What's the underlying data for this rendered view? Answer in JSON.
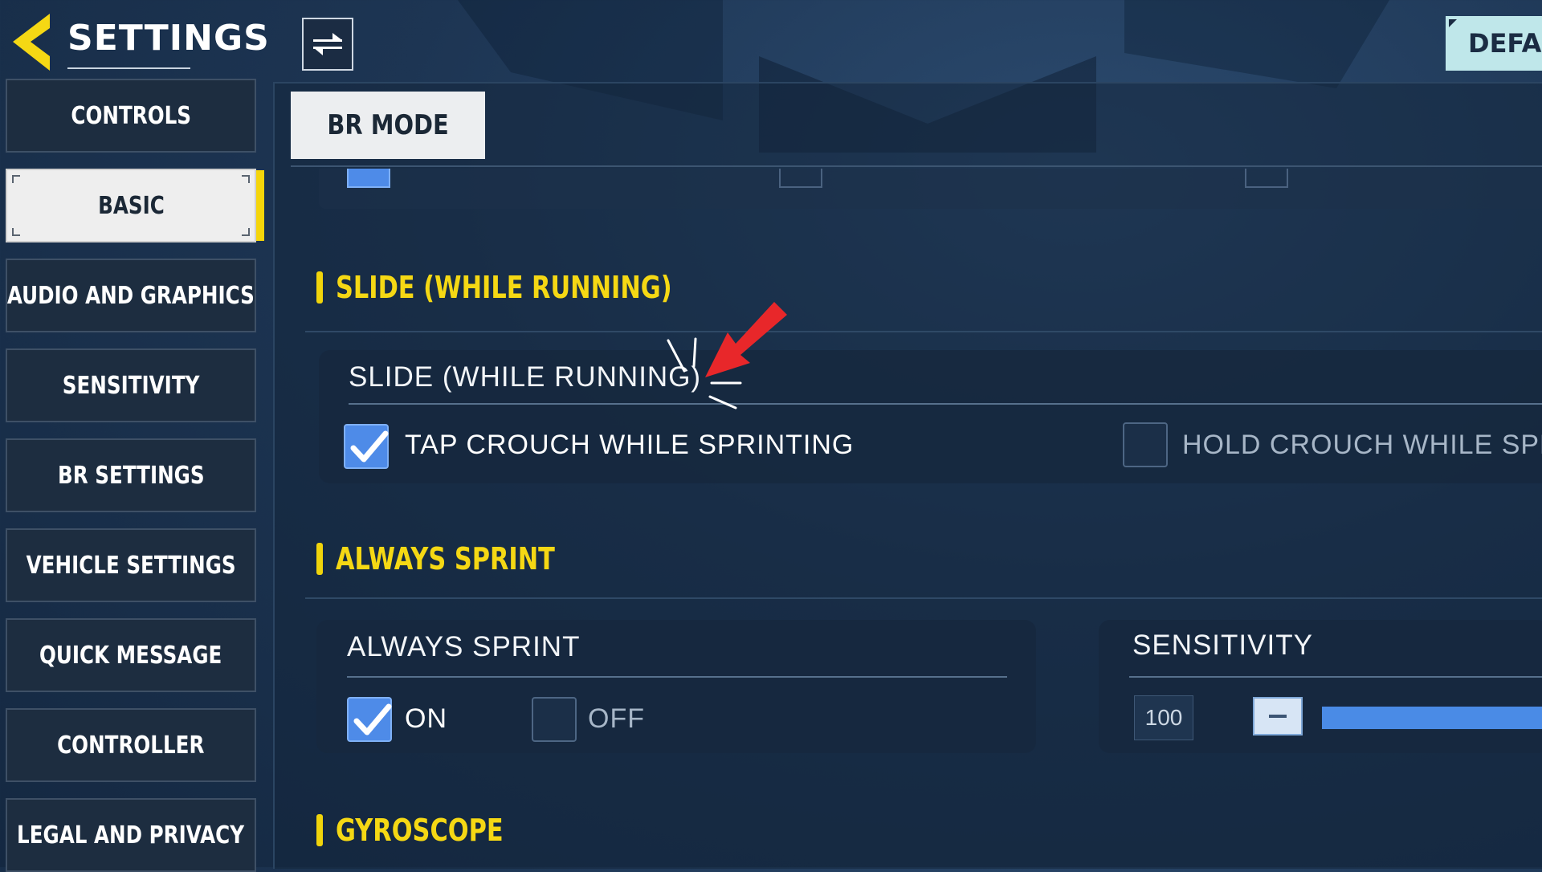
{
  "header": {
    "title": "SETTINGS",
    "default_label": "DEFAU"
  },
  "sidebar": {
    "items": [
      {
        "label": "CONTROLS",
        "active": false
      },
      {
        "label": "BASIC",
        "active": true
      },
      {
        "label": "AUDIO AND GRAPHICS",
        "active": false
      },
      {
        "label": "SENSITIVITY",
        "active": false
      },
      {
        "label": "BR SETTINGS",
        "active": false
      },
      {
        "label": "VEHICLE SETTINGS",
        "active": false
      },
      {
        "label": "QUICK MESSAGE",
        "active": false
      },
      {
        "label": "CONTROLLER",
        "active": false
      },
      {
        "label": "LEGAL AND PRIVACY",
        "active": false
      }
    ]
  },
  "mode_tab": {
    "label": "BR MODE"
  },
  "sections": {
    "slide": {
      "title": "SLIDE (WHILE RUNNING)",
      "card_title": "SLIDE (WHILE RUNNING)",
      "option_tap": {
        "label": "TAP CROUCH WHILE SPRINTING",
        "checked": true
      },
      "option_hold": {
        "label": "HOLD CROUCH WHILE SPRIN",
        "checked": false
      }
    },
    "always_sprint": {
      "title": "ALWAYS SPRINT",
      "card_title": "ALWAYS SPRINT",
      "option_on": {
        "label": "ON",
        "checked": true
      },
      "option_off": {
        "label": "OFF",
        "checked": false
      },
      "sensitivity": {
        "title": "SENSITIVITY",
        "value": "100"
      }
    },
    "gyroscope": {
      "title": "GYROSCOPE"
    }
  },
  "colors": {
    "accent_yellow": "#f5d814",
    "checkbox_blue": "#4e8be8",
    "arrow_red": "#e8272a",
    "default_button": "#bfe7ea"
  }
}
